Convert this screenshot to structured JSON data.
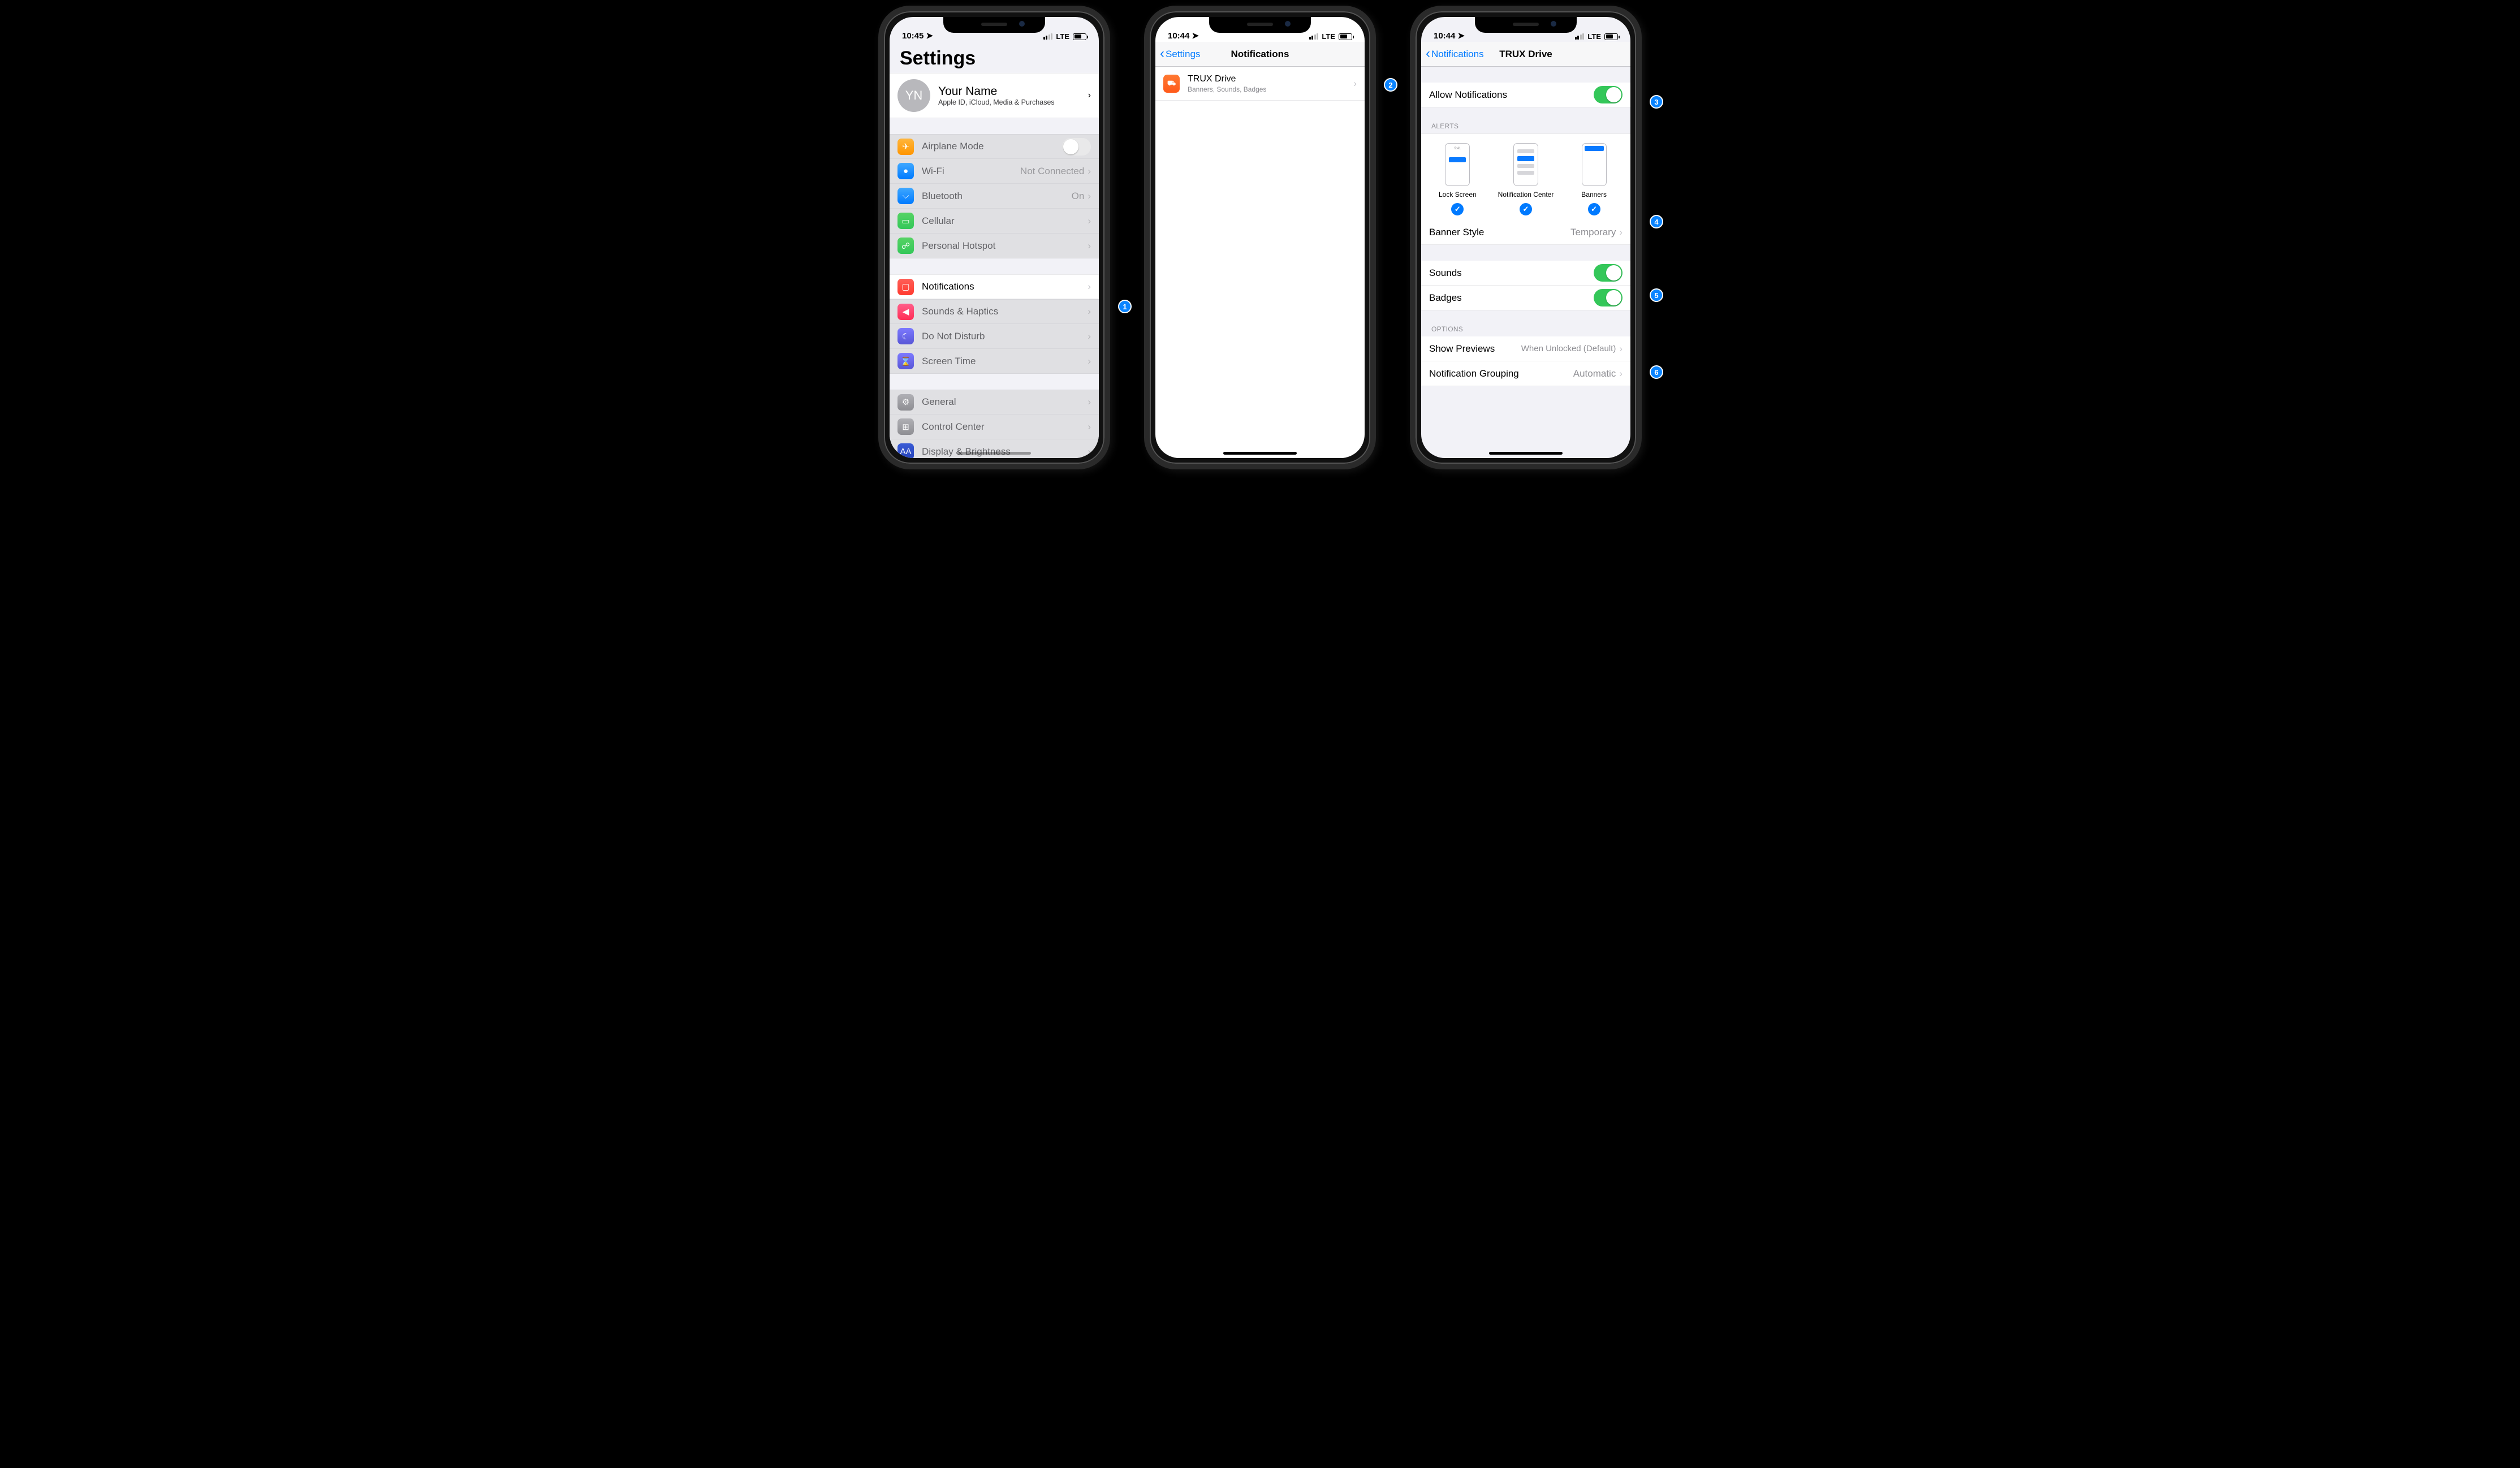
{
  "status": {
    "time1": "10:45",
    "time2": "10:44",
    "time3": "10:44",
    "carrier": "LTE"
  },
  "phone1": {
    "title": "Settings",
    "profile": {
      "initials": "YN",
      "name": "Your Name",
      "sub": "Apple ID, iCloud, Media & Purchases"
    },
    "groupA": [
      {
        "label": "Airplane Mode",
        "iconClass": "icon-orange-plane",
        "glyph": "✈",
        "toggle": "off"
      },
      {
        "label": "Wi-Fi",
        "iconClass": "icon-blue",
        "glyph": "●",
        "detail": "Not Connected"
      },
      {
        "label": "Bluetooth",
        "iconClass": "icon-blue",
        "glyph": "⌵",
        "detail": "On"
      },
      {
        "label": "Cellular",
        "iconClass": "icon-green",
        "glyph": "▭"
      },
      {
        "label": "Personal Hotspot",
        "iconClass": "icon-green",
        "glyph": "☍"
      }
    ],
    "highlight": {
      "label": "Notifications",
      "iconClass": "icon-red",
      "glyph": "◻"
    },
    "groupB_after": [
      {
        "label": "Sounds & Haptics",
        "iconClass": "icon-pink",
        "glyph": "◀"
      },
      {
        "label": "Do Not Disturb",
        "iconClass": "icon-purple",
        "glyph": "☾"
      },
      {
        "label": "Screen Time",
        "iconClass": "icon-purple",
        "glyph": "⌛"
      }
    ],
    "groupC": [
      {
        "label": "General",
        "iconClass": "icon-gray",
        "glyph": "⚙"
      },
      {
        "label": "Control Center",
        "iconClass": "icon-gray",
        "glyph": "⊞"
      },
      {
        "label": "Display & Brightness",
        "iconClass": "icon-darkblue",
        "glyph": "AA"
      }
    ]
  },
  "phone2": {
    "back": "Settings",
    "title": "Notifications",
    "app": {
      "name": "TRUX Drive",
      "sub": "Banners, Sounds, Badges"
    }
  },
  "phone3": {
    "back": "Notifications",
    "title": "TRUX Drive",
    "allow": "Allow Notifications",
    "alerts_header": "ALERTS",
    "alert_types": {
      "lock": "Lock Screen",
      "center": "Notification Center",
      "banners": "Banners",
      "time": "9:41"
    },
    "banner_style": {
      "label": "Banner Style",
      "value": "Temporary"
    },
    "sounds": "Sounds",
    "badges": "Badges",
    "options_header": "OPTIONS",
    "previews": {
      "label": "Show Previews",
      "value": "When Unlocked (Default)"
    },
    "grouping": {
      "label": "Notification Grouping",
      "value": "Automatic"
    }
  },
  "annotations": {
    "a1": "1",
    "a2": "2",
    "a3": "3",
    "a4": "4",
    "a5": "5",
    "a6": "6"
  }
}
